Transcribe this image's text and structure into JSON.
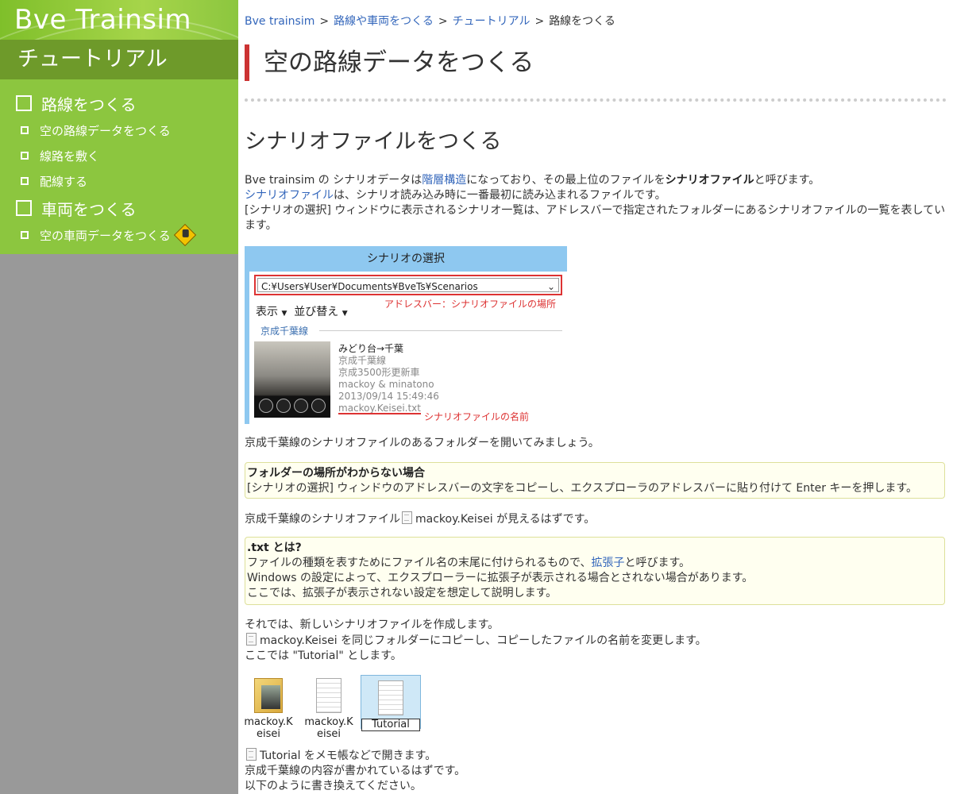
{
  "sidebar": {
    "logo": "Bve Trainsim",
    "section_title": "チュートリアル",
    "groups": [
      {
        "label": "路線をつくる",
        "items": [
          "空の路線データをつくる",
          "線路を敷く",
          "配線する"
        ]
      },
      {
        "label": "車両をつくる",
        "items": [
          "空の車両データをつくる"
        ]
      }
    ]
  },
  "breadcrumb": [
    "Bve trainsim",
    "路線や車両をつくる",
    "チュートリアル",
    "路線をつくる"
  ],
  "page_title": "空の路線データをつくる",
  "section_heading": "シナリオファイルをつくる",
  "intro": {
    "l1_a": "Bve trainsim の シナリオデータは",
    "l1_link": "階層構造",
    "l1_b": "になっており、その最上位のファイルを",
    "l1_bold": "シナリオファイル",
    "l1_c": "と呼びます。",
    "l2_link": "シナリオファイル",
    "l2_b": "は、シナリオ読み込み時に一番最初に読み込まれるファイルです。",
    "l3": "[シナリオの選択] ウィンドウに表示されるシナリオ一覧は、アドレスバーで指定されたフォルダーにあるシナリオファイルの一覧を表しています。"
  },
  "figure": {
    "window_title": "シナリオの選択",
    "address": "C:¥Users¥User¥Documents¥BveTs¥Scenarios",
    "address_note": "アドレスバー：シナリオファイルの場所",
    "toolbar_view": "表示",
    "toolbar_sort": "並び替え",
    "group": "京成千葉線",
    "route": "みどり台→千葉",
    "line": "京成千葉線",
    "vehicle": "京成3500形更新車",
    "author": "mackoy & minatono",
    "date": "2013/09/14 15:49:46",
    "file": "mackoy.Keisei.txt",
    "file_note": "シナリオファイルの名前"
  },
  "p_open": "京成千葉線のシナリオファイルのあるフォルダーを開いてみましょう。",
  "note1": {
    "title": "フォルダーの場所がわからない場合",
    "body": "[シナリオの選択] ウィンドウのアドレスバーの文字をコピーし、エクスプローラのアドレスバーに貼り付けて Enter キーを押します。"
  },
  "p_visible_a": "京成千葉線のシナリオファイル",
  "p_visible_file": "mackoy.Keisei",
  "p_visible_b": "が見えるはずです。",
  "note2": {
    "title": ".txt とは?",
    "l1_a": "ファイルの種類を表すためにファイル名の末尾に付けられるもので、",
    "l1_link": "拡張子",
    "l1_b": "と呼びます。",
    "l2": "Windows の設定によって、エクスプローラーに拡張子が表示される場合とされない場合があります。",
    "l3": "ここでは、拡張子が表示されない設定を想定して説明します。"
  },
  "create": {
    "l1": "それでは、新しいシナリオファイルを作成します。",
    "l2_file": "mackoy.Keisei",
    "l2_b": "を同じフォルダーにコピーし、コピーしたファイルの名前を変更します。",
    "l3": "ここでは \"Tutorial\" とします。"
  },
  "files": [
    "mackoy.Keisei",
    "mackoy.Keisei",
    "Tutorial"
  ],
  "open": {
    "l1_file": "Tutorial",
    "l1_b": "をメモ帳などで開きます。",
    "l2": "京成千葉線の内容が書かれているはずです。",
    "l3": "以下のように書き換えてください。"
  }
}
